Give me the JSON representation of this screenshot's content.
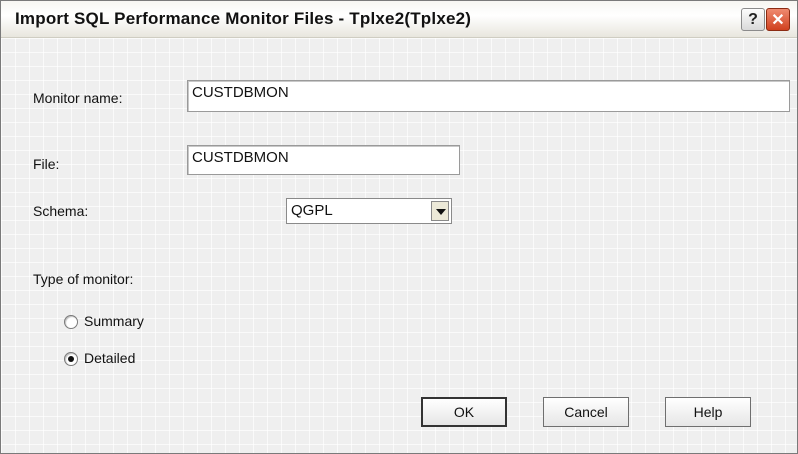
{
  "window": {
    "title": "Import SQL Performance Monitor Files - Tplxe2(Tplxe2)",
    "help_glyph": "?",
    "close_glyph": "✕"
  },
  "form": {
    "monitor_name_label": "Monitor name:",
    "monitor_name_value": "CUSTDBMON",
    "file_label": "File:",
    "file_value": "CUSTDBMON",
    "schema_label": "Schema:",
    "schema_value": "QGPL",
    "type_label": "Type of monitor:",
    "options": [
      {
        "label": "Summary",
        "selected": false
      },
      {
        "label": "Detailed",
        "selected": true
      }
    ]
  },
  "buttons": {
    "ok": "OK",
    "cancel": "Cancel",
    "help": "Help"
  }
}
